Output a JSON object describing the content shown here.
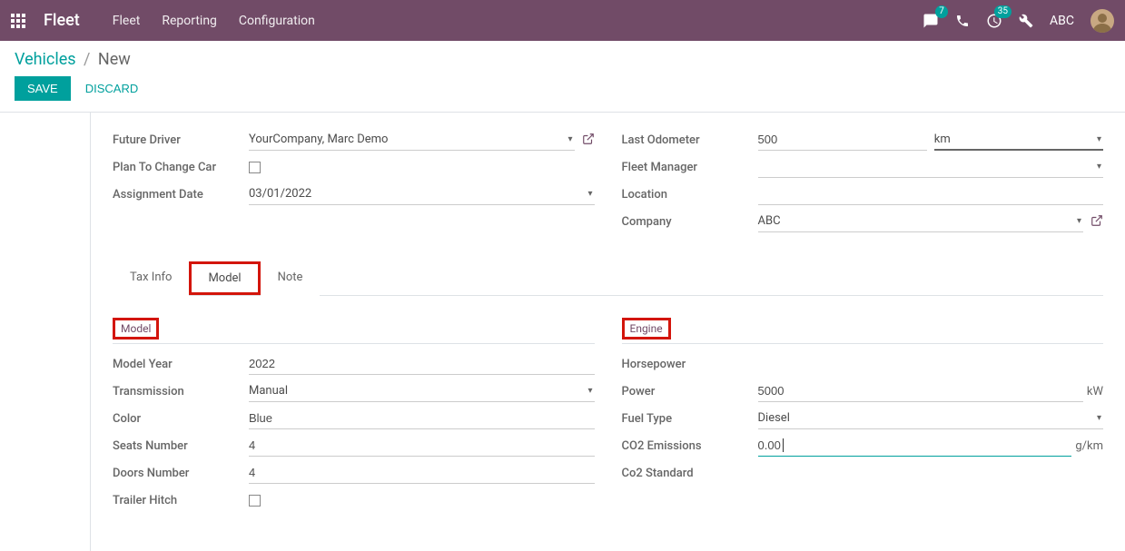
{
  "navbar": {
    "brand": "Fleet",
    "menu": [
      "Fleet",
      "Reporting",
      "Configuration"
    ],
    "messages_badge": "7",
    "activities_badge": "35",
    "user_name": "ABC"
  },
  "breadcrumb": {
    "root": "Vehicles",
    "current": "New"
  },
  "buttons": {
    "save": "SAVE",
    "discard": "DISCARD"
  },
  "left_fields": {
    "future_driver_label": "Future Driver",
    "future_driver_value": "YourCompany, Marc Demo",
    "plan_to_change_label": "Plan To Change Car",
    "assignment_date_label": "Assignment Date",
    "assignment_date_value": "03/01/2022"
  },
  "right_fields": {
    "last_odometer_label": "Last Odometer",
    "last_odometer_value": "500",
    "last_odometer_unit": "km",
    "fleet_manager_label": "Fleet Manager",
    "location_label": "Location",
    "company_label": "Company",
    "company_value": "ABC"
  },
  "tabs": {
    "tax_info": "Tax Info",
    "model": "Model",
    "note": "Note"
  },
  "model_group": {
    "title": "Model",
    "model_year_label": "Model Year",
    "model_year_value": "2022",
    "transmission_label": "Transmission",
    "transmission_value": "Manual",
    "color_label": "Color",
    "color_value": "Blue",
    "seats_label": "Seats Number",
    "seats_value": "4",
    "doors_label": "Doors Number",
    "doors_value": "4",
    "trailer_hitch_label": "Trailer Hitch"
  },
  "engine_group": {
    "title": "Engine",
    "horsepower_label": "Horsepower",
    "power_label": "Power",
    "power_value": "5000",
    "power_unit": "kW",
    "fuel_type_label": "Fuel Type",
    "fuel_type_value": "Diesel",
    "co2_emissions_label": "CO2 Emissions",
    "co2_emissions_value": "0.00",
    "co2_emissions_unit": "g/km",
    "co2_standard_label": "Co2 Standard"
  }
}
